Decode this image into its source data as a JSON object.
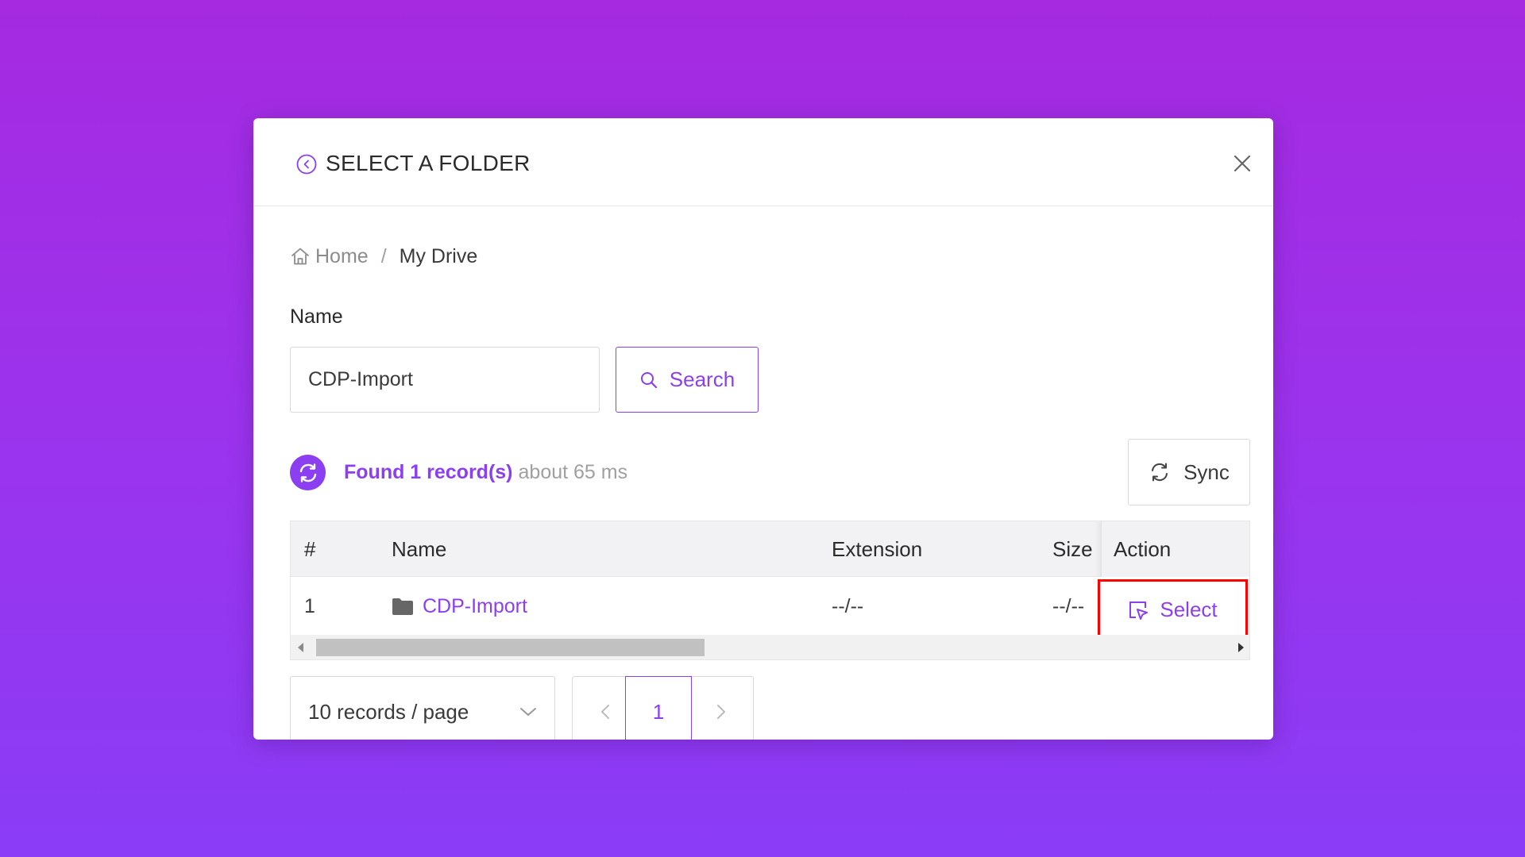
{
  "modal": {
    "title": "SELECT A FOLDER"
  },
  "breadcrumb": {
    "home": "Home",
    "separator": "/",
    "current": "My Drive"
  },
  "filter": {
    "name_label": "Name",
    "name_value": "CDP-Import",
    "search_label": "Search"
  },
  "status": {
    "found": "Found 1 record(s)",
    "time": "about 65 ms"
  },
  "sync_label": "Sync",
  "table": {
    "headers": {
      "index": "#",
      "name": "Name",
      "extension": "Extension",
      "size": "Size",
      "action": "Action"
    },
    "rows": [
      {
        "index": "1",
        "name": "CDP-Import",
        "extension": "--/--",
        "size": "--/--",
        "action": "Select"
      }
    ]
  },
  "pagination": {
    "page_size": "10 records / page",
    "current_page": "1"
  },
  "colors": {
    "accent": "#8b3ff0",
    "highlight": "#ff0000",
    "background_top": "#a52ae0",
    "background_bottom": "#8a3cf6"
  }
}
